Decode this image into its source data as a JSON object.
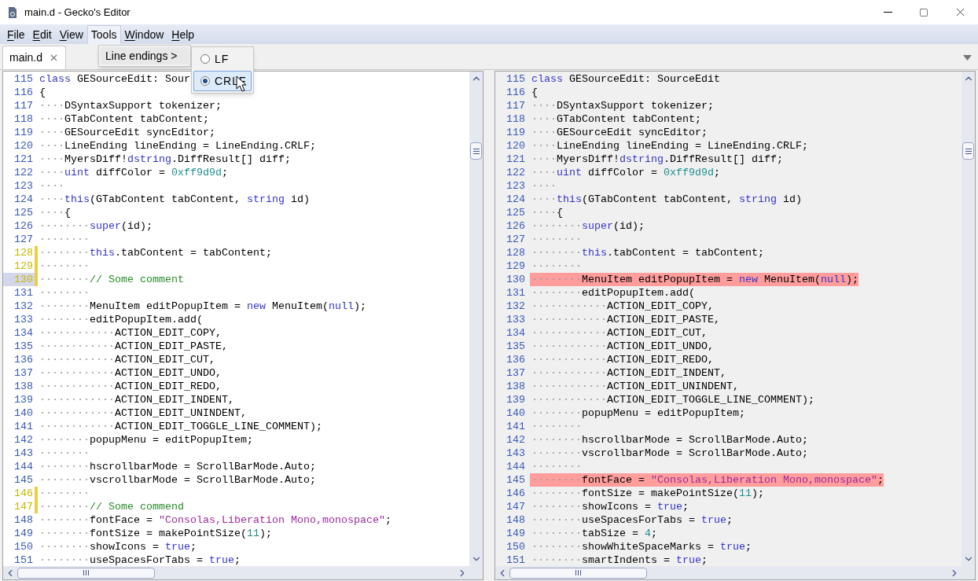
{
  "window": {
    "title": "main.d - Gecko's Editor"
  },
  "menu_bar": [
    {
      "label": "File",
      "underlined": true,
      "open": false
    },
    {
      "label": "Edit",
      "underlined": true,
      "open": false
    },
    {
      "label": "View",
      "underlined": true,
      "open": false
    },
    {
      "label": "Tools",
      "underlined": false,
      "open": true
    },
    {
      "label": "Window",
      "underlined": true,
      "open": false
    },
    {
      "label": "Help",
      "underlined": true,
      "open": false
    }
  ],
  "menu": {
    "items": [
      {
        "label": "Line endings >"
      }
    ],
    "submenu": [
      {
        "label": "LF",
        "checked": false,
        "highlighted": false
      },
      {
        "label": "CRLF",
        "checked": true,
        "highlighted": true
      }
    ]
  },
  "tabs": [
    {
      "label": "main.d",
      "selected": true
    }
  ],
  "panes": [
    {
      "read_only": false,
      "lines": [
        {
          "number": "115",
          "kind": "normal",
          "tokens": [
            {
              "text": "class",
              "kind": "keyword"
            },
            {
              "text": " GESourceEdit: Sour",
              "kind": "plain"
            }
          ]
        },
        {
          "number": "116",
          "kind": "normal",
          "tokens": [
            {
              "text": "{",
              "kind": "plain"
            }
          ]
        },
        {
          "number": "117",
          "kind": "normal",
          "tokens": [
            {
              "text": "····",
              "kind": "whitespace"
            },
            {
              "text": "DSyntaxSupport tokenizer;",
              "kind": "plain"
            }
          ]
        },
        {
          "number": "118",
          "kind": "normal",
          "tokens": [
            {
              "text": "····",
              "kind": "whitespace"
            },
            {
              "text": "GTabContent tabContent;",
              "kind": "plain"
            }
          ]
        },
        {
          "number": "119",
          "kind": "normal",
          "tokens": [
            {
              "text": "····",
              "kind": "whitespace"
            },
            {
              "text": "GESourceEdit syncEditor;",
              "kind": "plain"
            }
          ]
        },
        {
          "number": "120",
          "kind": "normal",
          "tokens": [
            {
              "text": "····",
              "kind": "whitespace"
            },
            {
              "text": "LineEnding lineEnding = LineEnding.CRLF;",
              "kind": "plain"
            }
          ]
        },
        {
          "number": "121",
          "kind": "normal",
          "tokens": [
            {
              "text": "····",
              "kind": "whitespace"
            },
            {
              "text": "MyersDiff!",
              "kind": "plain"
            },
            {
              "text": "dstring",
              "kind": "keyword"
            },
            {
              "text": ".DiffResult[] diff;",
              "kind": "plain"
            }
          ]
        },
        {
          "number": "122",
          "kind": "normal",
          "tokens": [
            {
              "text": "····",
              "kind": "whitespace"
            },
            {
              "text": "uint",
              "kind": "keyword"
            },
            {
              "text": " diffColor = ",
              "kind": "plain"
            },
            {
              "text": "0xff9d9d",
              "kind": "number"
            },
            {
              "text": ";",
              "kind": "plain"
            }
          ]
        },
        {
          "number": "123",
          "kind": "normal",
          "tokens": [
            {
              "text": "····",
              "kind": "whitespace"
            }
          ]
        },
        {
          "number": "124",
          "kind": "normal",
          "tokens": [
            {
              "text": "····",
              "kind": "whitespace"
            },
            {
              "text": "this",
              "kind": "keyword"
            },
            {
              "text": "(GTabContent tabContent, ",
              "kind": "plain"
            },
            {
              "text": "string",
              "kind": "keyword"
            },
            {
              "text": " id)",
              "kind": "plain"
            }
          ]
        },
        {
          "number": "125",
          "kind": "normal",
          "tokens": [
            {
              "text": "····",
              "kind": "whitespace"
            },
            {
              "text": "{",
              "kind": "plain"
            }
          ]
        },
        {
          "number": "126",
          "kind": "normal",
          "tokens": [
            {
              "text": "········",
              "kind": "whitespace"
            },
            {
              "text": "super",
              "kind": "keyword"
            },
            {
              "text": "(id);",
              "kind": "plain"
            }
          ]
        },
        {
          "number": "127",
          "kind": "normal",
          "tokens": [
            {
              "text": "········",
              "kind": "whitespace"
            }
          ]
        },
        {
          "number": "128",
          "kind": "changed",
          "tokens": [
            {
              "text": "········",
              "kind": "whitespace"
            },
            {
              "text": "this",
              "kind": "keyword"
            },
            {
              "text": ".tabContent = tabContent;",
              "kind": "plain"
            }
          ]
        },
        {
          "number": "129",
          "kind": "changed",
          "tokens": [
            {
              "text": "········",
              "kind": "whitespace"
            }
          ]
        },
        {
          "number": "130",
          "kind": "changed_current",
          "tokens": [
            {
              "text": "········",
              "kind": "whitespace"
            },
            {
              "text": "// Some comment",
              "kind": "comment"
            }
          ]
        },
        {
          "number": "131",
          "kind": "normal",
          "tokens": [
            {
              "text": "········",
              "kind": "whitespace"
            }
          ]
        },
        {
          "number": "132",
          "kind": "normal",
          "tokens": [
            {
              "text": "········",
              "kind": "whitespace"
            },
            {
              "text": "MenuItem editPopupItem = ",
              "kind": "plain"
            },
            {
              "text": "new",
              "kind": "keyword"
            },
            {
              "text": " MenuItem(",
              "kind": "plain"
            },
            {
              "text": "null",
              "kind": "keyword"
            },
            {
              "text": ");",
              "kind": "plain"
            }
          ]
        },
        {
          "number": "133",
          "kind": "normal",
          "tokens": [
            {
              "text": "········",
              "kind": "whitespace"
            },
            {
              "text": "editPopupItem.add(",
              "kind": "plain"
            }
          ]
        },
        {
          "number": "134",
          "kind": "normal",
          "tokens": [
            {
              "text": "············",
              "kind": "whitespace"
            },
            {
              "text": "ACTION_EDIT_COPY,",
              "kind": "plain"
            }
          ]
        },
        {
          "number": "135",
          "kind": "normal",
          "tokens": [
            {
              "text": "············",
              "kind": "whitespace"
            },
            {
              "text": "ACTION_EDIT_PASTE,",
              "kind": "plain"
            }
          ]
        },
        {
          "number": "136",
          "kind": "normal",
          "tokens": [
            {
              "text": "············",
              "kind": "whitespace"
            },
            {
              "text": "ACTION_EDIT_CUT,",
              "kind": "plain"
            }
          ]
        },
        {
          "number": "137",
          "kind": "normal",
          "tokens": [
            {
              "text": "············",
              "kind": "whitespace"
            },
            {
              "text": "ACTION_EDIT_UNDO,",
              "kind": "plain"
            }
          ]
        },
        {
          "number": "138",
          "kind": "normal",
          "tokens": [
            {
              "text": "············",
              "kind": "whitespace"
            },
            {
              "text": "ACTION_EDIT_REDO,",
              "kind": "plain"
            }
          ]
        },
        {
          "number": "139",
          "kind": "normal",
          "tokens": [
            {
              "text": "············",
              "kind": "whitespace"
            },
            {
              "text": "ACTION_EDIT_INDENT,",
              "kind": "plain"
            }
          ]
        },
        {
          "number": "140",
          "kind": "normal",
          "tokens": [
            {
              "text": "············",
              "kind": "whitespace"
            },
            {
              "text": "ACTION_EDIT_UNINDENT,",
              "kind": "plain"
            }
          ]
        },
        {
          "number": "141",
          "kind": "normal",
          "tokens": [
            {
              "text": "············",
              "kind": "whitespace"
            },
            {
              "text": "ACTION_EDIT_TOGGLE_LINE_COMMENT);",
              "kind": "plain"
            }
          ]
        },
        {
          "number": "142",
          "kind": "normal",
          "tokens": [
            {
              "text": "········",
              "kind": "whitespace"
            },
            {
              "text": "popupMenu = editPopupItem;",
              "kind": "plain"
            }
          ]
        },
        {
          "number": "143",
          "kind": "normal",
          "tokens": [
            {
              "text": "········",
              "kind": "whitespace"
            }
          ]
        },
        {
          "number": "144",
          "kind": "normal",
          "tokens": [
            {
              "text": "········",
              "kind": "whitespace"
            },
            {
              "text": "hscrollbarMode = ScrollBarMode.Auto;",
              "kind": "plain"
            }
          ]
        },
        {
          "number": "145",
          "kind": "normal",
          "tokens": [
            {
              "text": "········",
              "kind": "whitespace"
            },
            {
              "text": "vscrollbarMode = ScrollBarMode.Auto;",
              "kind": "plain"
            }
          ]
        },
        {
          "number": "146",
          "kind": "changed",
          "tokens": [
            {
              "text": "········",
              "kind": "whitespace"
            }
          ]
        },
        {
          "number": "147",
          "kind": "changed",
          "tokens": [
            {
              "text": "········",
              "kind": "whitespace"
            },
            {
              "text": "// Some commend",
              "kind": "comment"
            }
          ]
        },
        {
          "number": "148",
          "kind": "normal",
          "tokens": [
            {
              "text": "········",
              "kind": "whitespace"
            },
            {
              "text": "fontFace = ",
              "kind": "plain"
            },
            {
              "text": "\"Consolas,Liberation Mono,monospace\"",
              "kind": "string"
            },
            {
              "text": ";",
              "kind": "plain"
            }
          ]
        },
        {
          "number": "149",
          "kind": "normal",
          "tokens": [
            {
              "text": "········",
              "kind": "whitespace"
            },
            {
              "text": "fontSize = makePointSize(",
              "kind": "plain"
            },
            {
              "text": "11",
              "kind": "number"
            },
            {
              "text": ");",
              "kind": "plain"
            }
          ]
        },
        {
          "number": "150",
          "kind": "normal",
          "tokens": [
            {
              "text": "········",
              "kind": "whitespace"
            },
            {
              "text": "showIcons = ",
              "kind": "plain"
            },
            {
              "text": "true",
              "kind": "keyword"
            },
            {
              "text": ";",
              "kind": "plain"
            }
          ]
        },
        {
          "number": "151",
          "kind": "normal",
          "tokens": [
            {
              "text": "········",
              "kind": "whitespace"
            },
            {
              "text": "useSpacesForTabs = ",
              "kind": "plain"
            },
            {
              "text": "true",
              "kind": "keyword"
            },
            {
              "text": ";",
              "kind": "plain"
            }
          ]
        }
      ]
    },
    {
      "read_only": true,
      "lines": [
        {
          "number": "115",
          "kind": "normal",
          "tokens": [
            {
              "text": "class",
              "kind": "keyword"
            },
            {
              "text": " GESourceEdit: SourceEdit",
              "kind": "plain"
            }
          ]
        },
        {
          "number": "116",
          "kind": "normal",
          "tokens": [
            {
              "text": "{",
              "kind": "plain"
            }
          ]
        },
        {
          "number": "117",
          "kind": "normal",
          "tokens": [
            {
              "text": "····",
              "kind": "whitespace"
            },
            {
              "text": "DSyntaxSupport tokenizer;",
              "kind": "plain"
            }
          ]
        },
        {
          "number": "118",
          "kind": "normal",
          "tokens": [
            {
              "text": "····",
              "kind": "whitespace"
            },
            {
              "text": "GTabContent tabContent;",
              "kind": "plain"
            }
          ]
        },
        {
          "number": "119",
          "kind": "normal",
          "tokens": [
            {
              "text": "····",
              "kind": "whitespace"
            },
            {
              "text": "GESourceEdit syncEditor;",
              "kind": "plain"
            }
          ]
        },
        {
          "number": "120",
          "kind": "normal",
          "tokens": [
            {
              "text": "····",
              "kind": "whitespace"
            },
            {
              "text": "LineEnding lineEnding = LineEnding.CRLF;",
              "kind": "plain"
            }
          ]
        },
        {
          "number": "121",
          "kind": "normal",
          "tokens": [
            {
              "text": "····",
              "kind": "whitespace"
            },
            {
              "text": "MyersDiff!",
              "kind": "plain"
            },
            {
              "text": "dstring",
              "kind": "keyword"
            },
            {
              "text": ".DiffResult[] diff;",
              "kind": "plain"
            }
          ]
        },
        {
          "number": "122",
          "kind": "normal",
          "tokens": [
            {
              "text": "····",
              "kind": "whitespace"
            },
            {
              "text": "uint",
              "kind": "keyword"
            },
            {
              "text": " diffColor = ",
              "kind": "plain"
            },
            {
              "text": "0xff9d9d",
              "kind": "number"
            },
            {
              "text": ";",
              "kind": "plain"
            }
          ]
        },
        {
          "number": "123",
          "kind": "normal",
          "tokens": [
            {
              "text": "····",
              "kind": "whitespace"
            }
          ]
        },
        {
          "number": "124",
          "kind": "normal",
          "tokens": [
            {
              "text": "····",
              "kind": "whitespace"
            },
            {
              "text": "this",
              "kind": "keyword"
            },
            {
              "text": "(GTabContent tabContent, ",
              "kind": "plain"
            },
            {
              "text": "string",
              "kind": "keyword"
            },
            {
              "text": " id)",
              "kind": "plain"
            }
          ]
        },
        {
          "number": "125",
          "kind": "normal",
          "tokens": [
            {
              "text": "····",
              "kind": "whitespace"
            },
            {
              "text": "{",
              "kind": "plain"
            }
          ]
        },
        {
          "number": "126",
          "kind": "normal",
          "tokens": [
            {
              "text": "········",
              "kind": "whitespace"
            },
            {
              "text": "super",
              "kind": "keyword"
            },
            {
              "text": "(id);",
              "kind": "plain"
            }
          ]
        },
        {
          "number": "127",
          "kind": "normal",
          "tokens": [
            {
              "text": "········",
              "kind": "whitespace"
            }
          ]
        },
        {
          "number": "128",
          "kind": "normal",
          "tokens": [
            {
              "text": "········",
              "kind": "whitespace"
            },
            {
              "text": "this",
              "kind": "keyword"
            },
            {
              "text": ".tabContent = tabContent;",
              "kind": "plain"
            }
          ]
        },
        {
          "number": "129",
          "kind": "normal",
          "tokens": [
            {
              "text": "········",
              "kind": "whitespace"
            }
          ]
        },
        {
          "number": "130",
          "kind": "diff",
          "tokens": [
            {
              "text": "········",
              "kind": "whitespace"
            },
            {
              "text": "MenuItem editPopupItem = ",
              "kind": "plain"
            },
            {
              "text": "new",
              "kind": "keyword"
            },
            {
              "text": " MenuItem(",
              "kind": "plain"
            },
            {
              "text": "null",
              "kind": "keyword"
            },
            {
              "text": ");",
              "kind": "plain"
            }
          ]
        },
        {
          "number": "131",
          "kind": "normal",
          "tokens": [
            {
              "text": "········",
              "kind": "whitespace"
            },
            {
              "text": "editPopupItem.add(",
              "kind": "plain"
            }
          ]
        },
        {
          "number": "132",
          "kind": "normal",
          "tokens": [
            {
              "text": "············",
              "kind": "whitespace"
            },
            {
              "text": "ACTION_EDIT_COPY,",
              "kind": "plain"
            }
          ]
        },
        {
          "number": "133",
          "kind": "normal",
          "tokens": [
            {
              "text": "············",
              "kind": "whitespace"
            },
            {
              "text": "ACTION_EDIT_PASTE,",
              "kind": "plain"
            }
          ]
        },
        {
          "number": "134",
          "kind": "normal",
          "tokens": [
            {
              "text": "············",
              "kind": "whitespace"
            },
            {
              "text": "ACTION_EDIT_CUT,",
              "kind": "plain"
            }
          ]
        },
        {
          "number": "135",
          "kind": "normal",
          "tokens": [
            {
              "text": "············",
              "kind": "whitespace"
            },
            {
              "text": "ACTION_EDIT_UNDO,",
              "kind": "plain"
            }
          ]
        },
        {
          "number": "136",
          "kind": "normal",
          "tokens": [
            {
              "text": "············",
              "kind": "whitespace"
            },
            {
              "text": "ACTION_EDIT_REDO,",
              "kind": "plain"
            }
          ]
        },
        {
          "number": "137",
          "kind": "normal",
          "tokens": [
            {
              "text": "············",
              "kind": "whitespace"
            },
            {
              "text": "ACTION_EDIT_INDENT,",
              "kind": "plain"
            }
          ]
        },
        {
          "number": "138",
          "kind": "normal",
          "tokens": [
            {
              "text": "············",
              "kind": "whitespace"
            },
            {
              "text": "ACTION_EDIT_UNINDENT,",
              "kind": "plain"
            }
          ]
        },
        {
          "number": "139",
          "kind": "normal",
          "tokens": [
            {
              "text": "············",
              "kind": "whitespace"
            },
            {
              "text": "ACTION_EDIT_TOGGLE_LINE_COMMENT);",
              "kind": "plain"
            }
          ]
        },
        {
          "number": "140",
          "kind": "normal",
          "tokens": [
            {
              "text": "········",
              "kind": "whitespace"
            },
            {
              "text": "popupMenu = editPopupItem;",
              "kind": "plain"
            }
          ]
        },
        {
          "number": "141",
          "kind": "normal",
          "tokens": [
            {
              "text": "········",
              "kind": "whitespace"
            }
          ]
        },
        {
          "number": "142",
          "kind": "normal",
          "tokens": [
            {
              "text": "········",
              "kind": "whitespace"
            },
            {
              "text": "hscrollbarMode = ScrollBarMode.Auto;",
              "kind": "plain"
            }
          ]
        },
        {
          "number": "143",
          "kind": "normal",
          "tokens": [
            {
              "text": "········",
              "kind": "whitespace"
            },
            {
              "text": "vscrollbarMode = ScrollBarMode.Auto;",
              "kind": "plain"
            }
          ]
        },
        {
          "number": "144",
          "kind": "normal",
          "tokens": [
            {
              "text": "········",
              "kind": "whitespace"
            }
          ]
        },
        {
          "number": "145",
          "kind": "diff",
          "tokens": [
            {
              "text": "········",
              "kind": "whitespace"
            },
            {
              "text": "fontFace = ",
              "kind": "plain"
            },
            {
              "text": "\"Consolas,Liberation Mono,monospace\"",
              "kind": "string"
            },
            {
              "text": ";",
              "kind": "plain"
            }
          ]
        },
        {
          "number": "146",
          "kind": "normal",
          "tokens": [
            {
              "text": "········",
              "kind": "whitespace"
            },
            {
              "text": "fontSize = makePointSize(",
              "kind": "plain"
            },
            {
              "text": "11",
              "kind": "number"
            },
            {
              "text": ");",
              "kind": "plain"
            }
          ]
        },
        {
          "number": "147",
          "kind": "normal",
          "tokens": [
            {
              "text": "········",
              "kind": "whitespace"
            },
            {
              "text": "showIcons = ",
              "kind": "plain"
            },
            {
              "text": "true",
              "kind": "keyword"
            },
            {
              "text": ";",
              "kind": "plain"
            }
          ]
        },
        {
          "number": "148",
          "kind": "normal",
          "tokens": [
            {
              "text": "········",
              "kind": "whitespace"
            },
            {
              "text": "useSpacesForTabs = ",
              "kind": "plain"
            },
            {
              "text": "true",
              "kind": "keyword"
            },
            {
              "text": ";",
              "kind": "plain"
            }
          ]
        },
        {
          "number": "149",
          "kind": "normal",
          "tokens": [
            {
              "text": "········",
              "kind": "whitespace"
            },
            {
              "text": "tabSize = ",
              "kind": "plain"
            },
            {
              "text": "4",
              "kind": "number"
            },
            {
              "text": ";",
              "kind": "plain"
            }
          ]
        },
        {
          "number": "150",
          "kind": "normal",
          "tokens": [
            {
              "text": "········",
              "kind": "whitespace"
            },
            {
              "text": "showWhiteSpaceMarks = ",
              "kind": "plain"
            },
            {
              "text": "true",
              "kind": "keyword"
            },
            {
              "text": ";",
              "kind": "plain"
            }
          ]
        },
        {
          "number": "151",
          "kind": "normal",
          "tokens": [
            {
              "text": "········",
              "kind": "whitespace"
            },
            {
              "text": "smartIndents = ",
              "kind": "plain"
            },
            {
              "text": "true",
              "kind": "keyword"
            },
            {
              "text": ";",
              "kind": "plain"
            }
          ]
        }
      ]
    }
  ]
}
